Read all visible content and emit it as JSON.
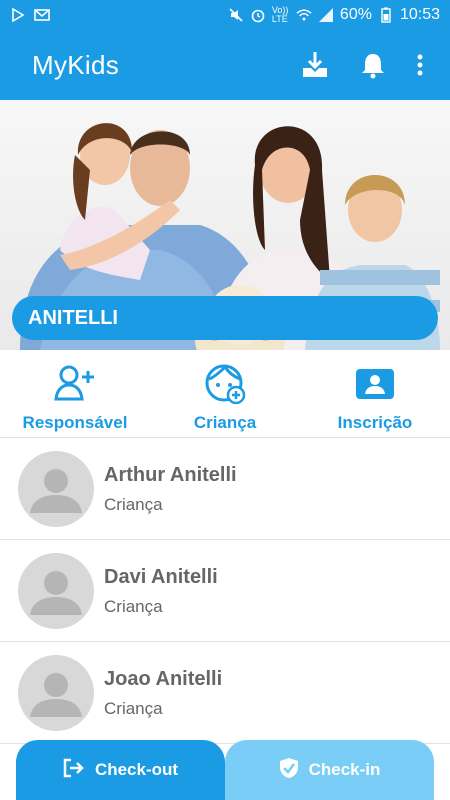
{
  "status_bar": {
    "left_icons": [
      "play-store-icon",
      "mail-icon"
    ],
    "right_icons": [
      "mute-icon",
      "alarm-icon",
      "volte-icon",
      "wifi-icon",
      "signal-icon",
      "battery-icon"
    ],
    "volte_text": "Vo)) LTE",
    "battery": "60%",
    "time": "10:53"
  },
  "app_bar": {
    "title": "MyKids",
    "actions": [
      "download-icon",
      "bell-icon",
      "more-vert-icon"
    ]
  },
  "hero": {
    "family_name": "ANITELLI"
  },
  "quick_actions": [
    {
      "label": "Responsável",
      "icon": "add-person-icon"
    },
    {
      "label": "Criança",
      "icon": "child-add-icon"
    },
    {
      "label": "Inscrição",
      "icon": "id-card-icon"
    }
  ],
  "children": [
    {
      "name": "Arthur Anitelli",
      "role": "Criança"
    },
    {
      "name": "Davi Anitelli",
      "role": "Criança"
    },
    {
      "name": "Joao Anitelli",
      "role": "Criança"
    }
  ],
  "bottom_bar": {
    "checkout_label": "Check-out",
    "checkin_label": "Check-in"
  },
  "colors": {
    "primary": "#1a9be3",
    "primary_light": "#79cdf7",
    "text_gray": "#666666"
  }
}
